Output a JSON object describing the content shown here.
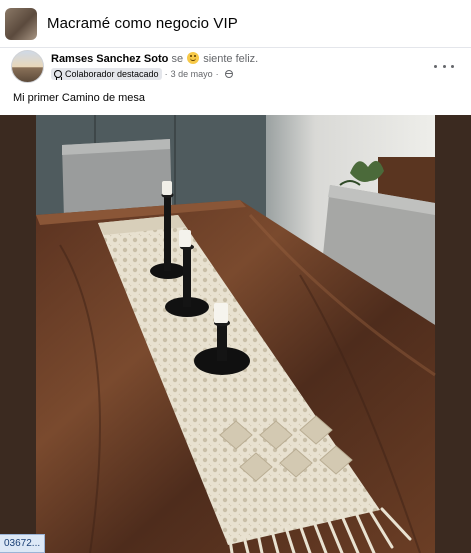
{
  "group": {
    "name": "Macramé como negocio VIP"
  },
  "post": {
    "author": "Ramses Sanchez Soto",
    "feeling_prefix": "se",
    "feeling_text": "siente feliz.",
    "badge": "Colaborador destacado",
    "separator": "·",
    "date": "3 de mayo",
    "text": "Mi primer Camino de mesa"
  },
  "status_bar": {
    "text": "03672..."
  },
  "icons": {
    "feeling": "smile-emoji-icon",
    "badge": "top-contributor-badge-icon",
    "privacy": "globe-icon",
    "more": "more-options-icon"
  }
}
